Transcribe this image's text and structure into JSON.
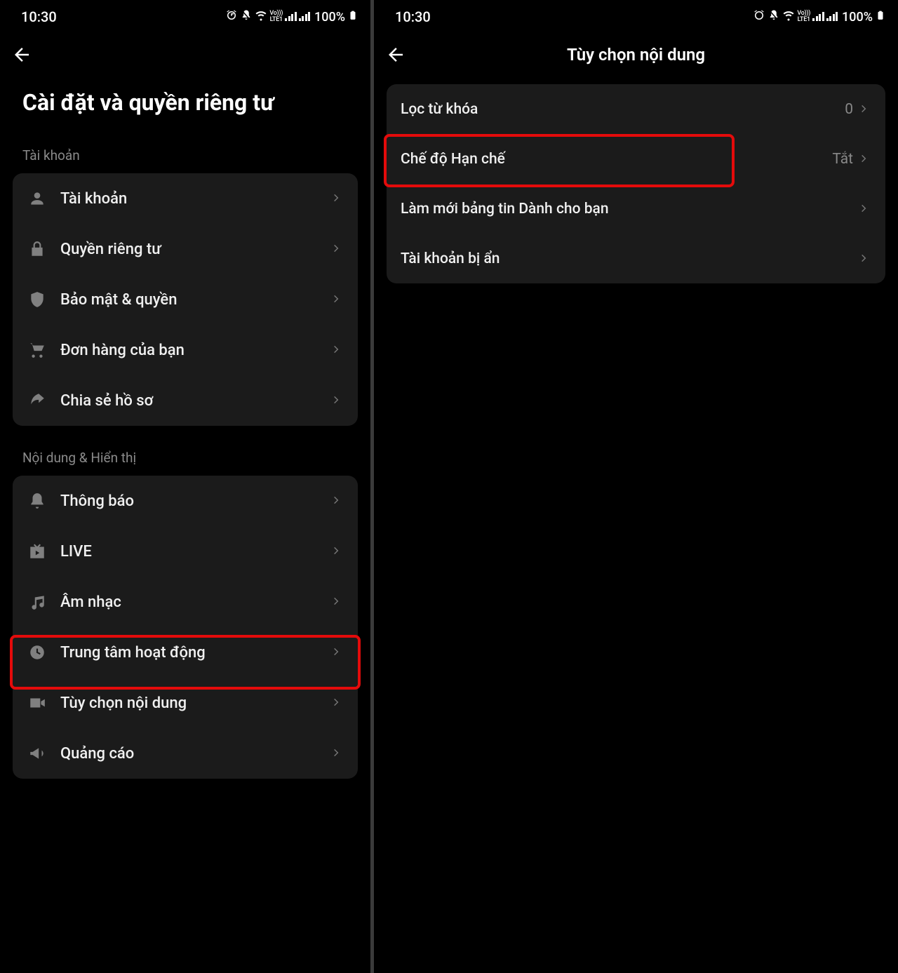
{
  "status": {
    "time": "10:30",
    "battery": "100%"
  },
  "left": {
    "title": "Cài đặt và quyền riêng tư",
    "section_account": "Tài khoản",
    "account_rows": [
      "Tài khoản",
      "Quyền riêng tư",
      "Bảo mật & quyền",
      "Đơn hàng của bạn",
      "Chia sẻ hồ sơ"
    ],
    "section_content": "Nội dung & Hiển thị",
    "content_rows": [
      "Thông báo",
      "LIVE",
      "Âm nhạc",
      "Trung tâm hoạt động",
      "Tùy chọn nội dung",
      "Quảng cáo"
    ]
  },
  "right": {
    "title": "Tùy chọn nội dung",
    "rows": [
      {
        "label": "Lọc từ khóa",
        "value": "0"
      },
      {
        "label": "Chế độ Hạn chế",
        "value": "Tắt"
      },
      {
        "label": "Làm mới bảng tin Dành cho bạn",
        "value": ""
      },
      {
        "label": "Tài khoản bị ẩn",
        "value": ""
      }
    ]
  }
}
